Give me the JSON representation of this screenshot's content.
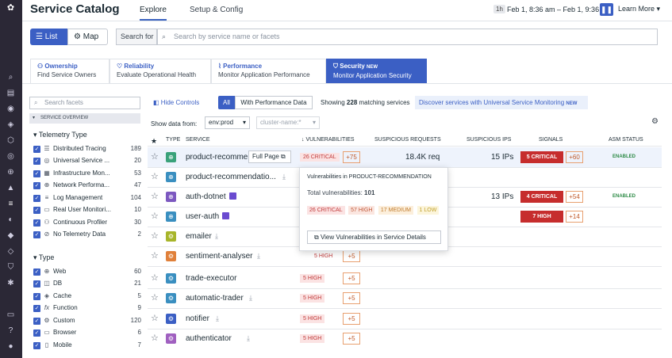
{
  "header": {
    "title": "Service Catalog",
    "tabs": [
      "Explore",
      "Setup & Config"
    ],
    "time_badge": "1h",
    "time_range": "Feb 1, 8:36 am – Feb 1, 9:36 am",
    "learn_more": "Learn More"
  },
  "view": {
    "list_label": "List",
    "map_label": "Map",
    "search_for": "Search for",
    "search_placeholder": "Search by service name or facets"
  },
  "categories": [
    {
      "title": "Ownership",
      "subtitle": "Find Service Owners"
    },
    {
      "title": "Reliability",
      "subtitle": "Evaluate Operational Health"
    },
    {
      "title": "Performance",
      "subtitle": "Monitor Application Performance"
    },
    {
      "title": "Security",
      "badge": "NEW",
      "subtitle": "Monitor Application Security"
    }
  ],
  "facets": {
    "search_placeholder": "Search facets",
    "overview": "SERVICE OVERVIEW",
    "telemetry_header": "Telemetry Type",
    "telemetry": [
      {
        "label": "Distributed Tracing",
        "count": "189"
      },
      {
        "label": "Universal Service ...",
        "count": "20"
      },
      {
        "label": "Infrastructure Mon...",
        "count": "53"
      },
      {
        "label": "Network Performa...",
        "count": "47"
      },
      {
        "label": "Log Management",
        "count": "104"
      },
      {
        "label": "Real User Monitori...",
        "count": "10"
      },
      {
        "label": "Continuous Profiler",
        "count": "30"
      },
      {
        "label": "No Telemetry Data",
        "count": "2"
      }
    ],
    "type_header": "Type",
    "types": [
      {
        "label": "Web",
        "count": "60"
      },
      {
        "label": "DB",
        "count": "21"
      },
      {
        "label": "Cache",
        "count": "5"
      },
      {
        "label": "Function",
        "count": "9"
      },
      {
        "label": "Custom",
        "count": "120"
      },
      {
        "label": "Browser",
        "count": "6"
      },
      {
        "label": "Mobile",
        "count": "7"
      }
    ]
  },
  "controls": {
    "hide": "Hide Controls",
    "all": "All",
    "with_perf": "With Performance Data",
    "matching_pre": "Showing ",
    "matching_count": "228",
    "matching_post": " matching services",
    "discover": "Discover services with Universal Service Monitoring",
    "discover_badge": "NEW",
    "show_data_from": "Show data from:",
    "env": "env:prod",
    "cluster": "cluster-name:*"
  },
  "table": {
    "headers": {
      "type": "TYPE",
      "service": "SERVICE",
      "vulns": "VULNERABILITIES",
      "requests": "SUSPICIOUS REQUESTS",
      "ips": "SUSPICIOUS IPS",
      "signals": "SIGNALS",
      "asm": "ASM STATUS"
    },
    "rows": [
      {
        "name": "product-recomme",
        "vuln": "26 CRITICAL",
        "vplus": "+75",
        "req": "18.4K req",
        "ips": "15 IPs",
        "sig": "5 CRITICAL",
        "splus": "+60",
        "asm": "ENABLED"
      },
      {
        "name": "product-recommendatio...",
        "vuln": "",
        "vplus": "",
        "req": "",
        "ips": "",
        "sig": "",
        "splus": "",
        "asm": ""
      },
      {
        "name": "auth-dotnet",
        "vuln": "",
        "vplus": "",
        "req": "",
        "ips": "13 IPs",
        "sig": "4 CRITICAL",
        "splus": "+54",
        "asm": "ENABLED"
      },
      {
        "name": "user-auth",
        "vuln": "",
        "vplus": "",
        "req": "",
        "ips": "",
        "sig": "7 HIGH",
        "splus": "+14",
        "asm": ""
      },
      {
        "name": "emailer",
        "vuln": "",
        "vplus": "",
        "req": "",
        "ips": "",
        "sig": "",
        "splus": "",
        "asm": ""
      },
      {
        "name": "sentiment-analyser",
        "vuln": "5 HIGH",
        "vplus": "+5",
        "req": "",
        "ips": "",
        "sig": "",
        "splus": "",
        "asm": ""
      },
      {
        "name": "trade-executor",
        "vuln": "5 HIGH",
        "vplus": "+5",
        "req": "",
        "ips": "",
        "sig": "",
        "splus": "",
        "asm": ""
      },
      {
        "name": "automatic-trader",
        "vuln": "5 HIGH",
        "vplus": "+5",
        "req": "",
        "ips": "",
        "sig": "",
        "splus": "",
        "asm": ""
      },
      {
        "name": "notifier",
        "vuln": "5 HIGH",
        "vplus": "+5",
        "req": "",
        "ips": "",
        "sig": "",
        "splus": "",
        "asm": ""
      },
      {
        "name": "authenticator",
        "vuln": "5 HIGH",
        "vplus": "+5",
        "req": "",
        "ips": "",
        "sig": "",
        "splus": "",
        "asm": ""
      }
    ]
  },
  "tooltip": {
    "full_page": "Full Page"
  },
  "popup": {
    "title": "Vulnerabilities in PRODUCT-RECOMMENDATION",
    "total_label": "Total vulnerabilities: ",
    "total": "101",
    "pills": [
      "26 CRITICAL",
      "57 HIGH",
      "17 MEDIUM",
      "1 LOW"
    ],
    "button": "View Vulnerabilities in Service Details"
  }
}
